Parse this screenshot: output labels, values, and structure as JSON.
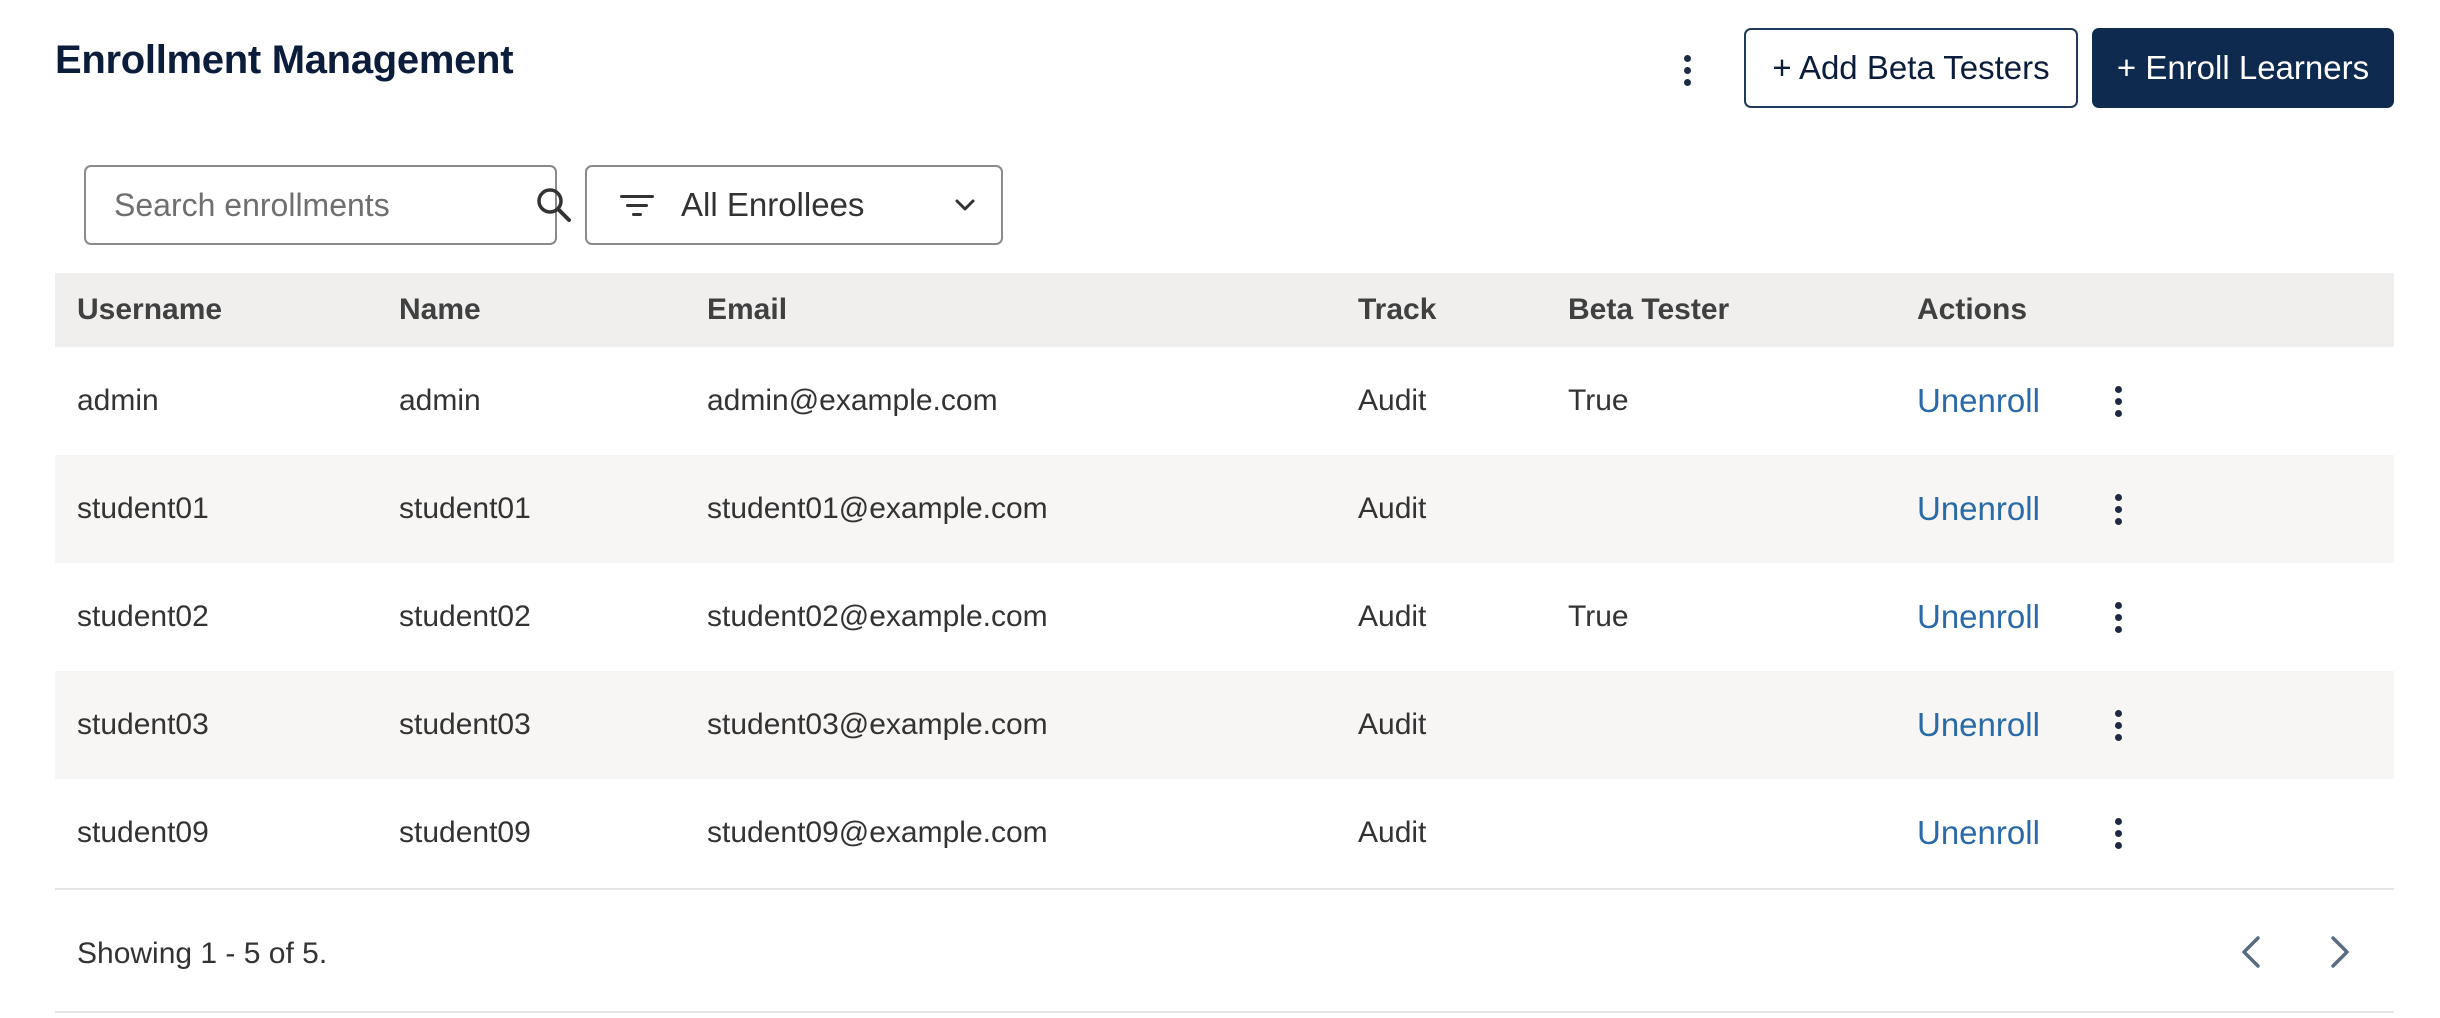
{
  "header": {
    "title": "Enrollment Management",
    "add_beta_label": "+ Add Beta Testers",
    "enroll_label": "+ Enroll Learners"
  },
  "search": {
    "placeholder": "Search enrollments",
    "value": ""
  },
  "filter": {
    "selected": "All Enrollees"
  },
  "table": {
    "columns": [
      "Username",
      "Name",
      "Email",
      "Track",
      "Beta Tester",
      "Actions"
    ],
    "action_label": "Unenroll",
    "rows": [
      {
        "username": "admin",
        "name": "admin",
        "email": "admin@example.com",
        "track": "Audit",
        "beta": "True"
      },
      {
        "username": "student01",
        "name": "student01",
        "email": "student01@example.com",
        "track": "Audit",
        "beta": ""
      },
      {
        "username": "student02",
        "name": "student02",
        "email": "student02@example.com",
        "track": "Audit",
        "beta": "True"
      },
      {
        "username": "student03",
        "name": "student03",
        "email": "student03@example.com",
        "track": "Audit",
        "beta": ""
      },
      {
        "username": "student09",
        "name": "student09",
        "email": "student09@example.com",
        "track": "Audit",
        "beta": ""
      }
    ]
  },
  "footer": {
    "showing": "Showing 1 - 5 of 5."
  },
  "colors": {
    "primary": "#0f2a4f",
    "link": "#2a6aa8",
    "header_bg": "#f0efed",
    "row_alt": "#f7f6f4"
  }
}
